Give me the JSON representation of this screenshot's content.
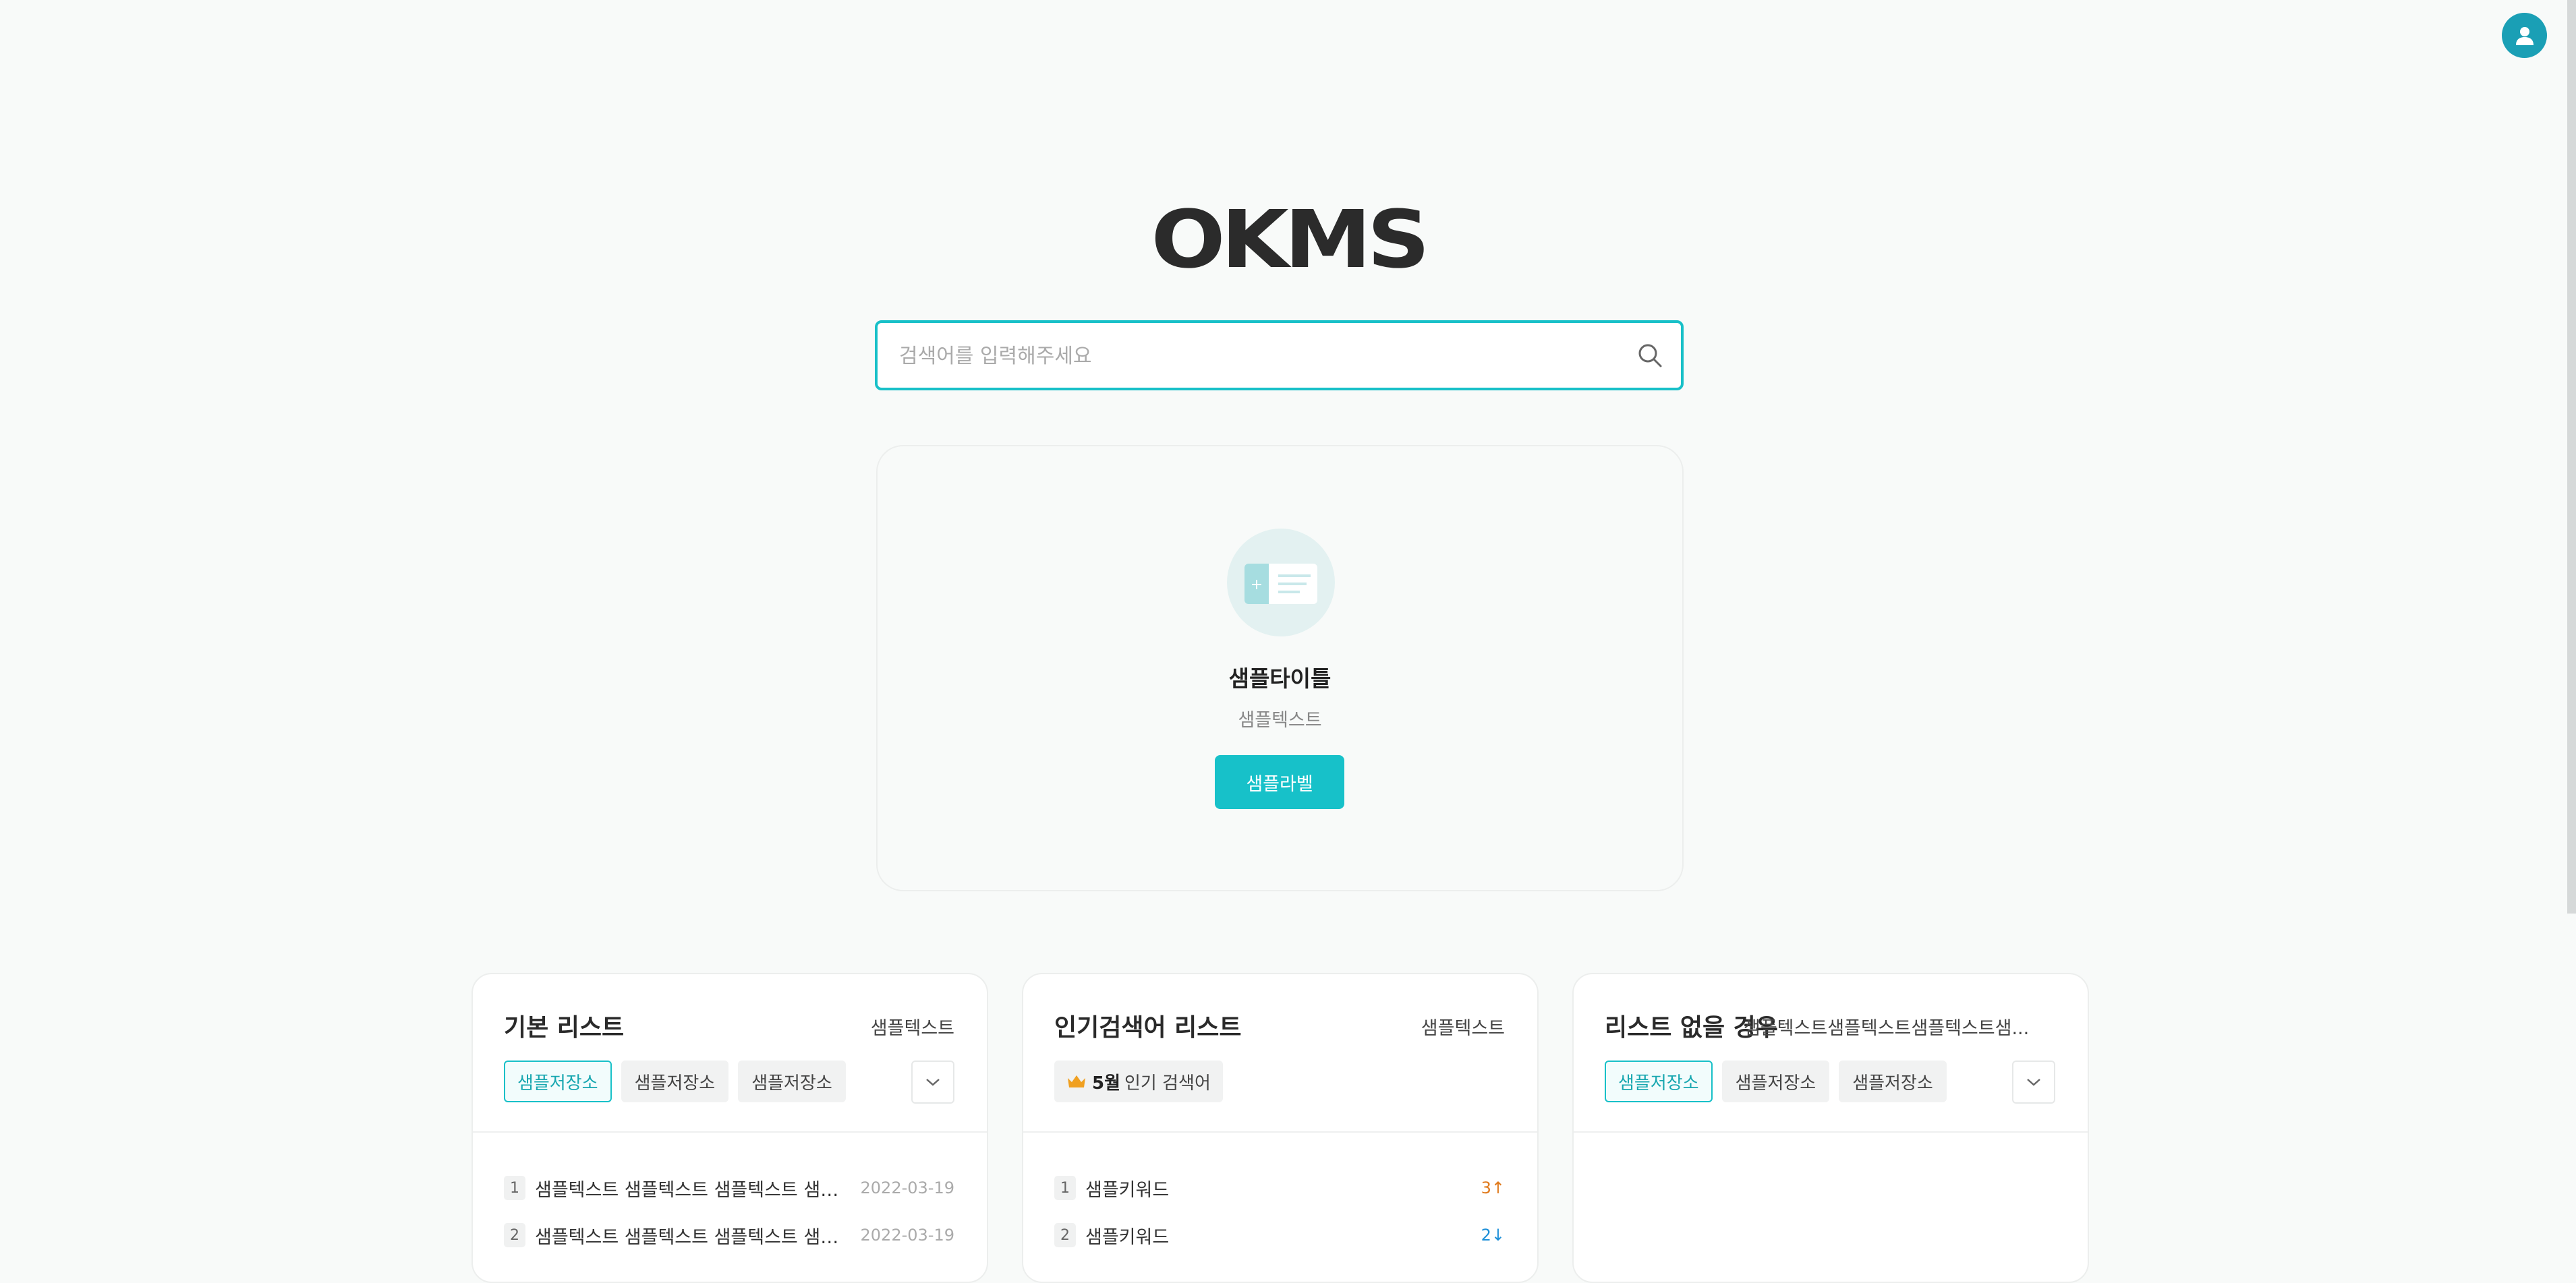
{
  "header": {
    "logo_text": "OKMS",
    "user_icon": "user-icon"
  },
  "search": {
    "placeholder": "검색어를 입력해주세요",
    "value": "",
    "icon": "search-icon"
  },
  "feature": {
    "icon": "document-card-icon",
    "title": "샘플타이틀",
    "text": "샘플텍스트",
    "button_label": "샘플라벨"
  },
  "panels": [
    {
      "title": "기본 리스트",
      "more": "샘플텍스트",
      "tabs": [
        "샘플저장소",
        "샘플저장소",
        "샘플저장소"
      ],
      "active_tab": 0,
      "items": [
        {
          "num": "1",
          "text": "샘플텍스트 샘플텍스트 샘플텍스트 샘플...",
          "date": "2022-03-19"
        },
        {
          "num": "2",
          "text": "샘플텍스트 샘플텍스트 샘플텍스트 샘플...",
          "date": "2022-03-19"
        }
      ]
    },
    {
      "title": "인기검색어 리스트",
      "more": "샘플텍스트",
      "badge_month": "5월",
      "badge_text": "인기 검색어",
      "items": [
        {
          "num": "1",
          "text": "샘플키워드",
          "rank": "3↑",
          "trend": "up"
        },
        {
          "num": "2",
          "text": "샘플키워드",
          "rank": "2↓",
          "trend": "down"
        }
      ]
    },
    {
      "title": "리스트 없을 경우",
      "more": "샘플텍스트샘플텍스트샘플텍스트샘...",
      "tabs": [
        "샘플저장소",
        "샘플저장소",
        "샘플저장소"
      ],
      "active_tab": 0,
      "items": []
    }
  ],
  "colors": {
    "accent": "#18c0c8",
    "avatar": "#1a9fb5",
    "up": "#e07a1c",
    "down": "#1d8fd8"
  }
}
